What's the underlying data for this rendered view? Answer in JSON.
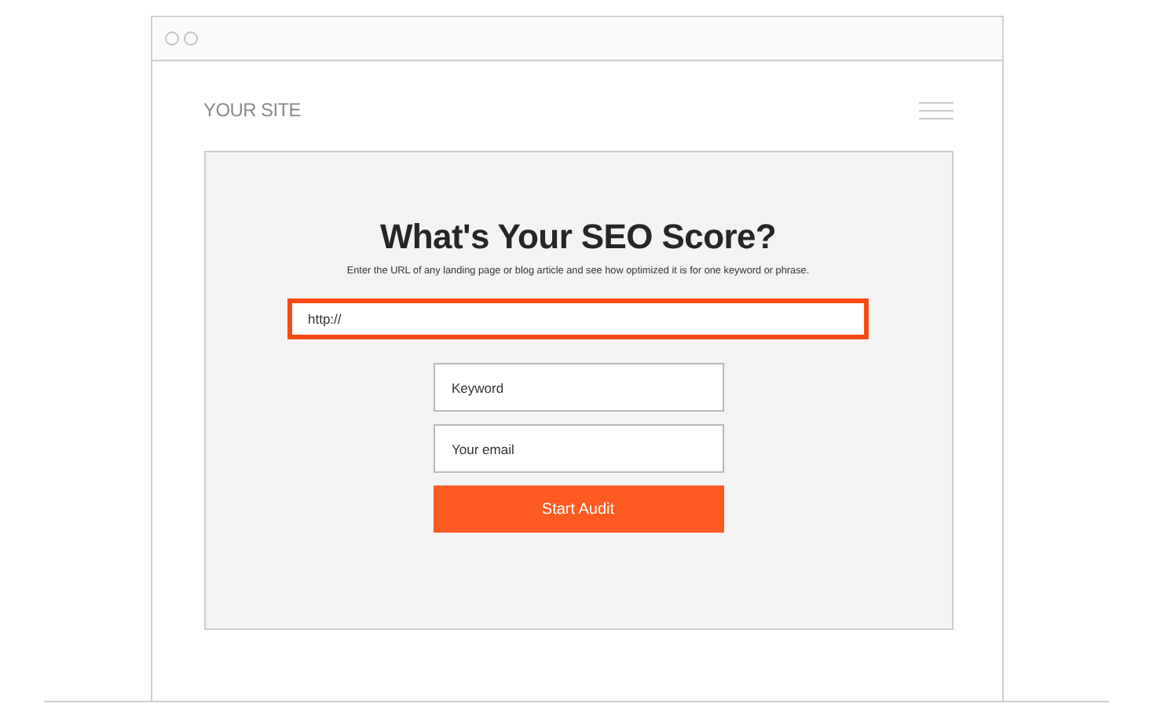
{
  "site": {
    "logo": "YOUR SITE"
  },
  "form": {
    "title": "What's Your SEO Score?",
    "subtitle": "Enter the URL of any landing page or blog article and see how optimized it is for one keyword or phrase.",
    "url": {
      "value": "http://",
      "focused": true
    },
    "fields": [
      {
        "placeholder": "Keyword"
      },
      {
        "placeholder": "Your email"
      }
    ],
    "button": "Start Audit"
  }
}
